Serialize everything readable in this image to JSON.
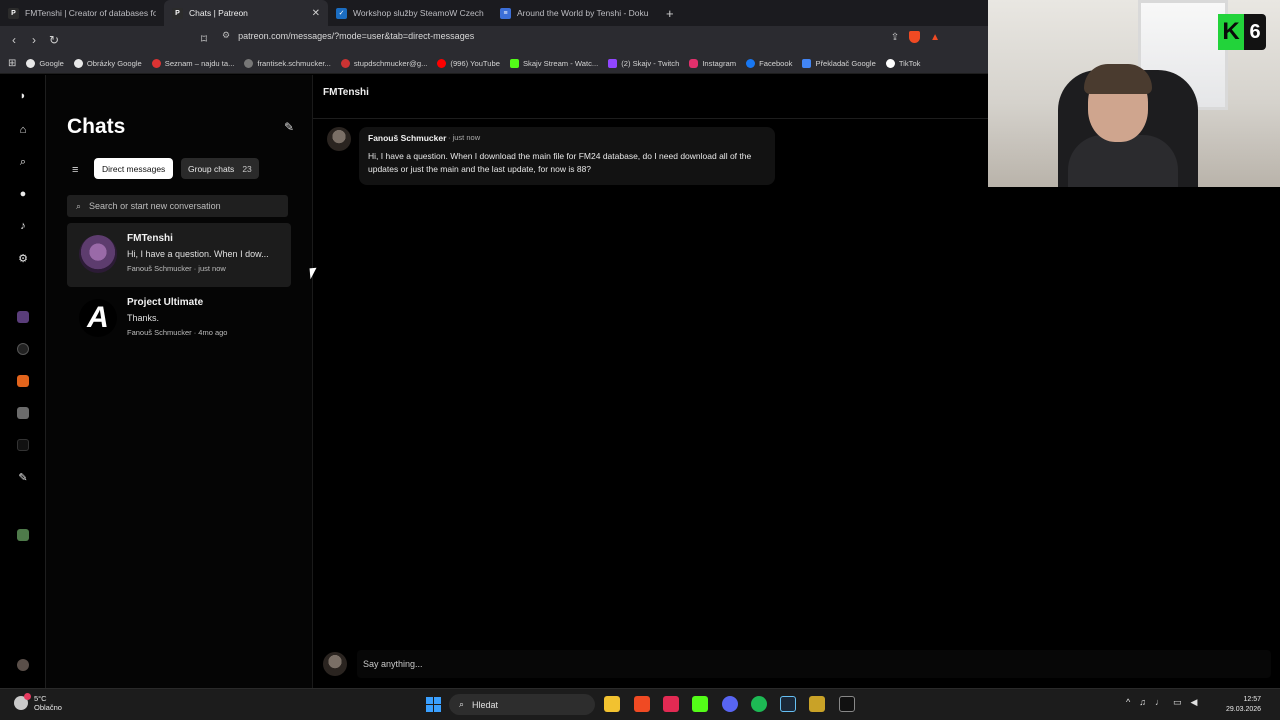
{
  "browser": {
    "tabs": [
      {
        "title": "FMTenshi | Creator of databases for F",
        "favicon_color": "#2b2b2b",
        "active": false
      },
      {
        "title": "Chats | Patreon",
        "favicon_color": "#2b2b2b",
        "active": true
      },
      {
        "title": "Workshop služby SteamoW Czech Re",
        "favicon_color": "#1b6dc1",
        "active": false
      },
      {
        "title": "Around the World by Tenshi - Dokum",
        "favicon_color": "#3c6fd8",
        "active": false
      }
    ],
    "url": "patreon.com/messages/?mode=user&tab=direct-messages",
    "bookmarks": [
      {
        "label": "Google",
        "color": "#e8e8e8"
      },
      {
        "label": "Obrázky Google",
        "color": "#e8e8e8"
      },
      {
        "label": "Seznam – najdu ta...",
        "color": "#d33"
      },
      {
        "label": "frantisek.schmucker...",
        "color": "#777"
      },
      {
        "label": "stupdschmucker@g...",
        "color": "#c33"
      },
      {
        "label": "(996) YouTube",
        "color": "#ff0000"
      },
      {
        "label": "Skajv Stream - Watc...",
        "color": "#53fc18"
      },
      {
        "label": "(2) Skajv - Twitch",
        "color": "#9146ff"
      },
      {
        "label": "Instagram",
        "color": "#e1306c"
      },
      {
        "label": "Facebook",
        "color": "#1877f2"
      },
      {
        "label": "Překladač Google",
        "color": "#4285f4"
      },
      {
        "label": "TikTok",
        "color": "#ffffff"
      }
    ]
  },
  "panel": {
    "title": "Chats",
    "filters": {
      "direct": "Direct messages",
      "group": "Group chats",
      "group_count": "23"
    },
    "search_placeholder": "Search or start new conversation",
    "conversations": [
      {
        "name": "FMTenshi",
        "preview": "Hi, I have a question. When I dow...",
        "meta": "Fanouš Schmucker · just now",
        "selected": true
      },
      {
        "name": "Project Ultimate",
        "preview": "Thanks.",
        "meta": "Fanouš Schmucker · 4mo ago",
        "selected": false
      }
    ]
  },
  "conversation": {
    "title": "FMTenshi",
    "messages": [
      {
        "author": "Fanouš Schmucker",
        "time": "just now",
        "text": "Hi, I have a question. When I download the main file for FM24 database, do I need download all of the updates or just the main and the last update, for now is 88?"
      }
    ],
    "compose_placeholder": "Say anything..."
  },
  "overlay": {
    "logo_letter": "K",
    "logo_number": "6",
    "accent": "#22d33a"
  },
  "taskbar": {
    "weather_temp": "5°C",
    "weather_desc": "Oblačno",
    "search_label": "Hledat",
    "time": "12:57",
    "date": "29.03.2026"
  }
}
